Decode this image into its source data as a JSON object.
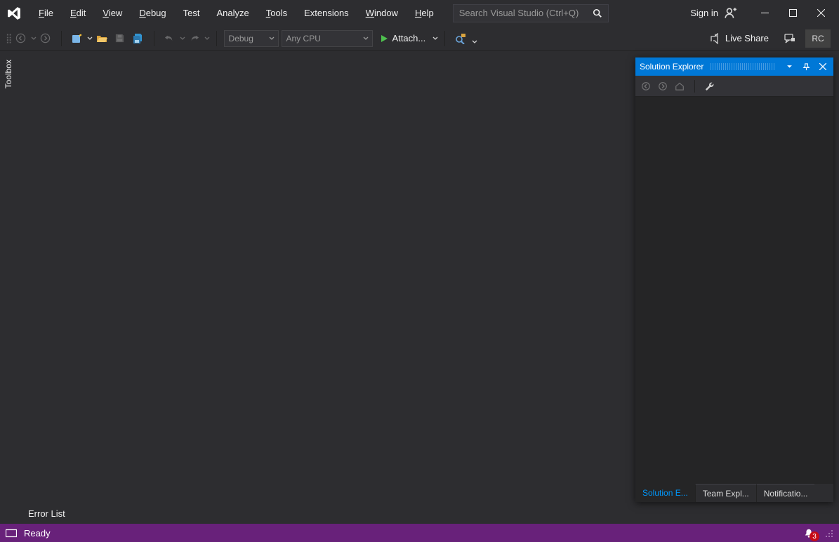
{
  "menu": {
    "items": [
      {
        "mnemonic": "F",
        "rest": "ile"
      },
      {
        "mnemonic": "E",
        "rest": "dit"
      },
      {
        "mnemonic": "V",
        "rest": "iew"
      },
      {
        "mnemonic": "D",
        "rest": "ebug"
      },
      {
        "mnemonic": "",
        "rest": "Test"
      },
      {
        "mnemonic": "",
        "rest": "Analyze"
      },
      {
        "mnemonic": "T",
        "rest": "ools"
      },
      {
        "mnemonic": "",
        "rest": "Extensions"
      },
      {
        "mnemonic": "W",
        "rest": "indow"
      },
      {
        "mnemonic": "H",
        "rest": "elp"
      }
    ]
  },
  "search": {
    "placeholder": "Search Visual Studio (Ctrl+Q)"
  },
  "titlebar": {
    "signin": "Sign in"
  },
  "toolbar": {
    "config": "Debug",
    "platform": "Any CPU",
    "attach": "Attach...",
    "liveshare": "Live Share",
    "profile": "RC"
  },
  "leftRail": {
    "toolbox": "Toolbox"
  },
  "solutionExplorer": {
    "title": "Solution Explorer",
    "tabs": [
      "Solution E...",
      "Team Expl...",
      "Notificatio..."
    ]
  },
  "bottomDock": {
    "errorList": "Error List"
  },
  "status": {
    "ready": "Ready",
    "notifications": "3"
  },
  "colors": {
    "accent": "#0078d7",
    "statusbar": "#68217a"
  }
}
